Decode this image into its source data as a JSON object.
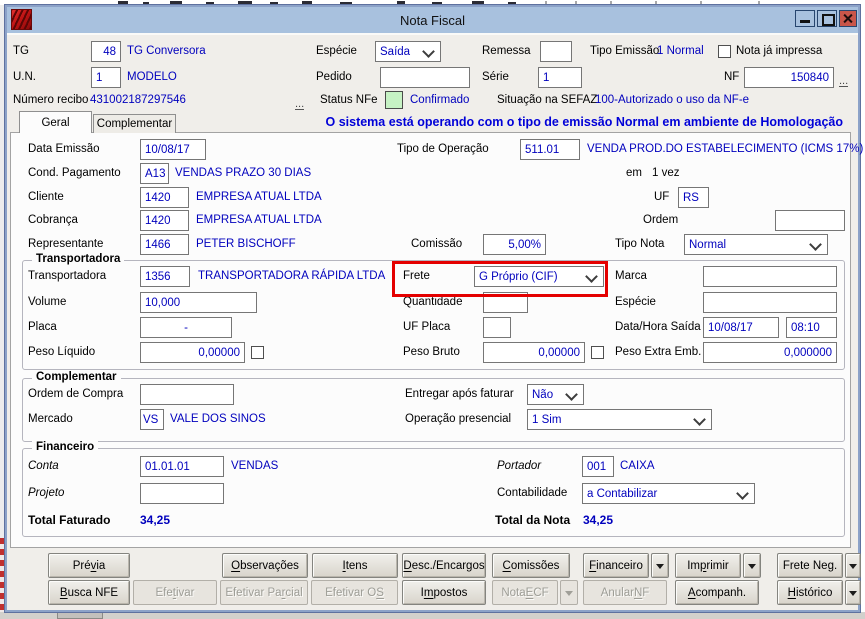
{
  "window": {
    "title": "Nota Fiscal"
  },
  "header": {
    "tg_label": "TG",
    "tg_code": "48",
    "tg_name": "TG Conversora",
    "un_label": "U.N.",
    "un_code": "1",
    "un_name": "MODELO",
    "especie_label": "Espécie",
    "especie_value": "Saída",
    "pedido_label": "Pedido",
    "pedido_value": "",
    "remessa_label": "Remessa",
    "remessa_value": "",
    "serie_label": "Série",
    "serie_value": "1",
    "tipo_emissao_label": "Tipo Emissão",
    "tipo_emissao_value": "1 Normal",
    "nf_label": "NF",
    "nf_value": "150840",
    "nf_browse": "...",
    "nota_impressa_label": "Nota já impressa",
    "recibo_label": "Número recibo",
    "recibo_value": "431002187297546",
    "recibo_browse": "...",
    "status_label": "Status NFe",
    "status_value": "Confirmado",
    "sefaz_label": "Situação na SEFAZ",
    "sefaz_value": "100-Autorizado o uso da NF-e"
  },
  "tabs": {
    "geral": "Geral",
    "complementar": "Complementar",
    "banner": "O sistema está operando com o tipo de emissão Normal em ambiente de Homologação"
  },
  "geral": {
    "data_emissao_label": "Data Emissão",
    "data_emissao_value": "10/08/17",
    "tipo_operacao_label": "Tipo de Operação",
    "tipo_operacao_code": "511.01",
    "tipo_operacao_desc": "VENDA PROD.DO ESTABELECIMENTO (ICMS 17%)",
    "cond_pagamento_label": "Cond. Pagamento",
    "cond_pagamento_code": "A13",
    "cond_pagamento_desc": "VENDAS PRAZO 30 DIAS",
    "em_label": "em",
    "em_value": "1 vez",
    "cliente_label": "Cliente",
    "cliente_code": "1420",
    "cliente_name": "EMPRESA ATUAL LTDA",
    "uf_label": "UF",
    "uf_value": "RS",
    "cobranca_label": "Cobrança",
    "cobranca_code": "1420",
    "cobranca_name": "EMPRESA ATUAL LTDA",
    "ordem_label": "Ordem",
    "ordem_value": "",
    "representante_label": "Representante",
    "representante_code": "1466",
    "representante_name": "PETER BISCHOFF",
    "comissao_label": "Comissão",
    "comissao_value": "5,00%",
    "tipo_nota_label": "Tipo Nota",
    "tipo_nota_value": "Normal"
  },
  "transportadora": {
    "title": "Transportadora",
    "transportadora_label": "Transportadora",
    "code": "1356",
    "name": "TRANSPORTADORA RÁPIDA LTDA",
    "frete_label": "Frete",
    "frete_value": "G Próprio (CIF)",
    "marca_label": "Marca",
    "marca_value": "",
    "volume_label": "Volume",
    "volume_value": "10,000",
    "quantidade_label": "Quantidade",
    "quantidade_value": "",
    "especie_label": "Espécie",
    "especie_value": "",
    "placa_label": "Placa",
    "placa_value": "-",
    "uf_placa_label": "UF Placa",
    "uf_placa_value": "",
    "data_hora_label": "Data/Hora Saída",
    "data_saida": "10/08/17",
    "hora_saida": "08:10",
    "peso_liquido_label": "Peso Líquido",
    "peso_liquido": "0,00000",
    "peso_bruto_label": "Peso Bruto",
    "peso_bruto": "0,00000",
    "peso_extra_label": "Peso Extra Emb.",
    "peso_extra": "0,000000"
  },
  "complementar": {
    "title": "Complementar",
    "ordem_compra_label": "Ordem de Compra",
    "ordem_compra_value": "",
    "entregar_label": "Entregar após faturar",
    "entregar_value": "Não",
    "mercado_label": "Mercado",
    "mercado_code": "VS",
    "mercado_name": "VALE DOS SINOS",
    "operacao_label": "Operação presencial",
    "operacao_value": "1 Sim"
  },
  "financeiro": {
    "title": "Financeiro",
    "conta_label": "Conta",
    "conta_code": "01.01.01",
    "conta_name": "VENDAS",
    "portador_label": "Portador",
    "portador_code": "001",
    "portador_name": "CAIXA",
    "projeto_label": "Projeto",
    "projeto_value": "",
    "contabilidade_label": "Contabilidade",
    "contabilidade_value": "a Contabilizar",
    "total_faturado_label": "Total Faturado",
    "total_faturado": "34,25",
    "total_nota_label": "Total da Nota",
    "total_nota": "34,25"
  },
  "buttons": {
    "previa": {
      "text": "Prévia",
      "u": 3
    },
    "observacoes": {
      "text": "Observações",
      "u": 0
    },
    "itens": {
      "text": "Itens",
      "u": 0
    },
    "desc_encargos": {
      "text": "Desc./Encargos",
      "u": 0
    },
    "comissoes": {
      "text": "Comissões",
      "u": 0
    },
    "financeiro": {
      "text": "Financeiro",
      "u": 0
    },
    "imprimir": {
      "text": "Imprimir",
      "u": 2
    },
    "frete_neg": {
      "text": "Frete Neg.",
      "u": null
    },
    "busca_nfe": {
      "text": "Busca NFE",
      "u": 0
    },
    "efetivar": {
      "text": "Efetivar",
      "u": 3
    },
    "efetivar_parcial": {
      "text": "Efetivar Parcial",
      "u": 11
    },
    "efetivar_os": {
      "text": "Efetivar OS",
      "u": 10
    },
    "impostos": {
      "text": "Impostos",
      "u": 1
    },
    "nota_ecf": {
      "text": "Nota ECF",
      "u": 5
    },
    "anular_nf": {
      "text": "Anular NF",
      "u": 7
    },
    "acompanh": {
      "text": "Acompanh.",
      "u": 0
    },
    "historico": {
      "text": "Histórico",
      "u": 0
    }
  },
  "colors": {
    "value_blue": "#0000bd",
    "banner_blue": "#0000d8",
    "status_green": "#c6f2c4",
    "highlight_red": "#e40000",
    "titlebar_blue": "#a8c1de"
  }
}
